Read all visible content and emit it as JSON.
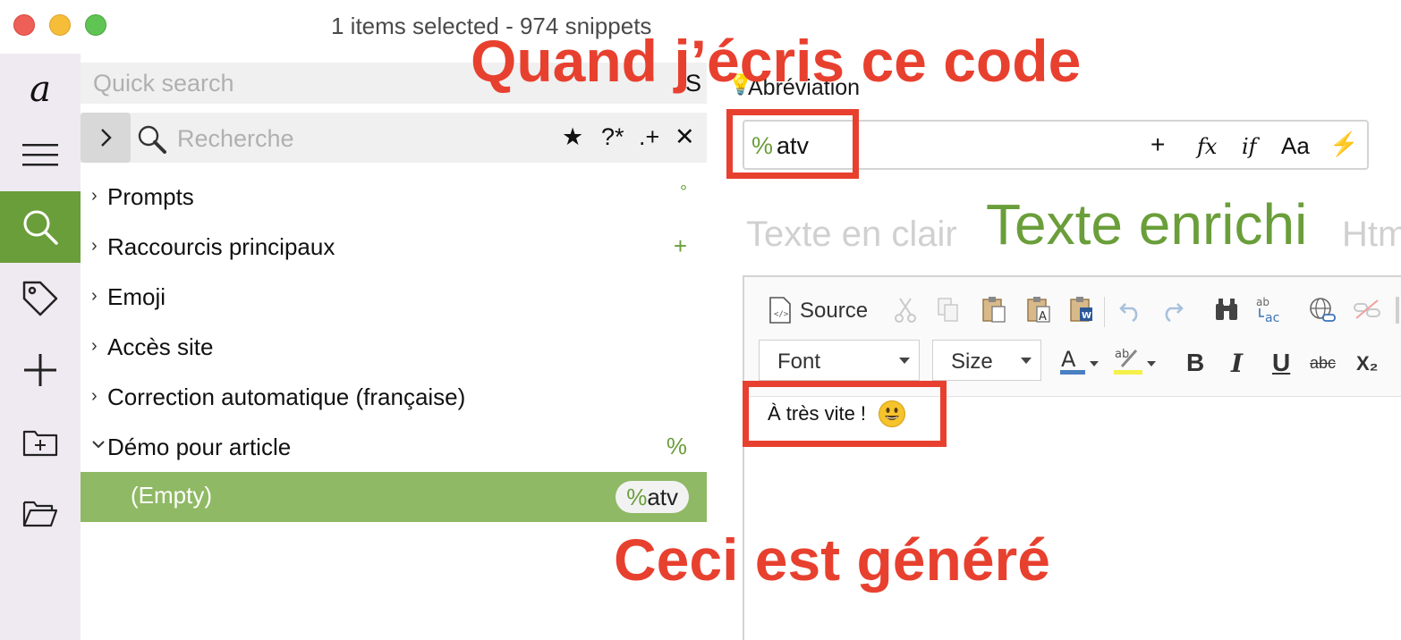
{
  "window": {
    "title": "1 items selected - 974 snippets",
    "controls": [
      "close",
      "minimize",
      "zoom"
    ]
  },
  "iconbar": {
    "items": [
      {
        "name": "app-logo-icon"
      },
      {
        "name": "menu-icon"
      },
      {
        "name": "search-icon",
        "active": true
      },
      {
        "name": "tag-icon"
      },
      {
        "name": "plus-icon"
      },
      {
        "name": "new-folder-icon"
      },
      {
        "name": "open-folder-icon"
      }
    ],
    "logo_glyph": "a"
  },
  "quick_search": {
    "placeholder": "Quick search",
    "trailing": "S"
  },
  "search": {
    "placeholder": "Recherche",
    "tools": [
      "★",
      "?*",
      ".+",
      "✕"
    ]
  },
  "tree": {
    "groups": [
      {
        "label": "Prompts",
        "badge": "°",
        "expanded": false
      },
      {
        "label": "Raccourcis principaux",
        "badge": "+",
        "expanded": false
      },
      {
        "label": "Emoji",
        "badge": "",
        "expanded": false
      },
      {
        "label": "Accès site",
        "badge": "",
        "expanded": false
      },
      {
        "label": "Correction automatique (française)",
        "badge": "",
        "expanded": false
      },
      {
        "label": "Démo pour article",
        "badge": "%",
        "expanded": true
      }
    ],
    "selected_snippet": {
      "label": "(Empty)",
      "abbr_prefix": "%",
      "abbr_suffix": "atv"
    }
  },
  "editor": {
    "abbreviation_label": "Abréviation",
    "abbreviation_prefix": "%",
    "abbreviation_value": "atv",
    "abbr_tools": [
      "+",
      "fx",
      "if",
      "Aa",
      "⚡"
    ],
    "tabs": {
      "plain": "Texte en clair",
      "rich": "Texte enrichi",
      "html": "Html"
    },
    "toolbar": {
      "source_label": "Source",
      "font_label": "Font",
      "size_label": "Size",
      "bold": "B",
      "italic": "I",
      "underline": "U",
      "strike": "abc",
      "subscript": "X₂"
    },
    "content": "À très vite !",
    "content_emoji": "smiley"
  },
  "annotations": {
    "top": "Quand j’écris ce code",
    "bottom": "Ceci est généré",
    "color": "#e8402f"
  },
  "colors": {
    "accent": "#6a9e3a",
    "selection": "#8fb964"
  }
}
